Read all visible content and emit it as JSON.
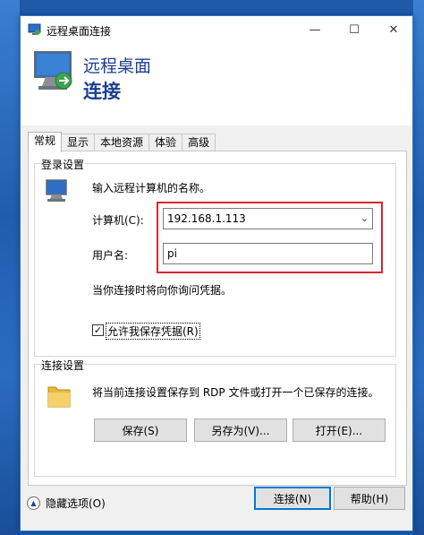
{
  "window": {
    "title": "远程桌面连接",
    "controls": {
      "minimize": "—",
      "maximize": "☐",
      "close": "✕"
    }
  },
  "banner": {
    "line1": "远程桌面",
    "line2": "连接"
  },
  "tabs": [
    {
      "label": "常规",
      "active": true
    },
    {
      "label": "显示",
      "active": false
    },
    {
      "label": "本地资源",
      "active": false
    },
    {
      "label": "体验",
      "active": false
    },
    {
      "label": "高级",
      "active": false
    }
  ],
  "login": {
    "group_title": "登录设置",
    "prompt": "输入远程计算机的名称。",
    "computer_label": "计算机(C):",
    "computer_value": "192.168.1.113",
    "username_label": "用户名:",
    "username_value": "pi",
    "credentials_note": "当你连接时将向你询问凭据。",
    "allow_save_label": "允许我保存凭据(R)",
    "allow_save_checked": true
  },
  "connection": {
    "group_title": "连接设置",
    "description": "将当前连接设置保存到 RDP 文件或打开一个已保存的连接。",
    "save_label": "保存(S)",
    "save_as_label": "另存为(V)...",
    "open_label": "打开(E)..."
  },
  "footer": {
    "hide_options_label": "隐藏选项(O)",
    "connect_label": "连接(N)",
    "help_label": "帮助(H)"
  },
  "colors": {
    "accent": "#0078d7",
    "highlight_box": "#d9272e",
    "banner_text": "#1b3f8f"
  }
}
